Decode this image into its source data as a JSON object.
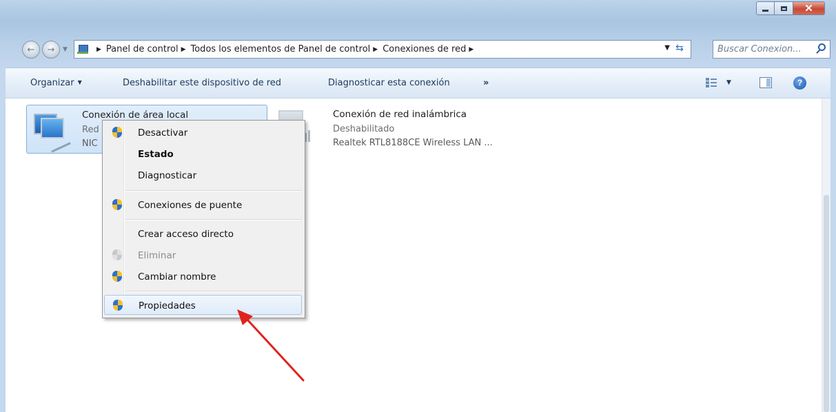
{
  "address_bar": {
    "crumbs": [
      "Panel de control",
      "Todos los elementos de Panel de control",
      "Conexiones de red"
    ],
    "search_placeholder": "Buscar Conexion..."
  },
  "toolbar": {
    "organize": "Organizar",
    "disable_device": "Deshabilitar este dispositivo de red",
    "diagnose": "Diagnosticar esta conexión",
    "more": "»"
  },
  "connections": [
    {
      "name": "Conexión de área local",
      "status": "Red",
      "device": "NIC"
    },
    {
      "name": "Conexión de red inalámbrica",
      "status": "Deshabilitado",
      "device": "Realtek RTL8188CE Wireless LAN ..."
    }
  ],
  "context_menu": {
    "items": [
      {
        "label": "Desactivar",
        "icon": "shield-icon"
      },
      {
        "label": "Estado",
        "bold": true
      },
      {
        "label": "Diagnosticar"
      },
      {
        "label": "Conexiones de puente",
        "icon": "shield-icon"
      },
      {
        "label": "Crear acceso directo"
      },
      {
        "label": "Eliminar",
        "icon": "shield-icon",
        "disabled": true
      },
      {
        "label": "Cambiar nombre",
        "icon": "shield-icon"
      },
      {
        "label": "Propiedades",
        "icon": "shield-icon",
        "highlighted": true
      }
    ]
  },
  "colors": {
    "annotation_arrow": "#e0231c",
    "menu_highlight": "#dfecfa",
    "selection": "#cfe3f8"
  }
}
